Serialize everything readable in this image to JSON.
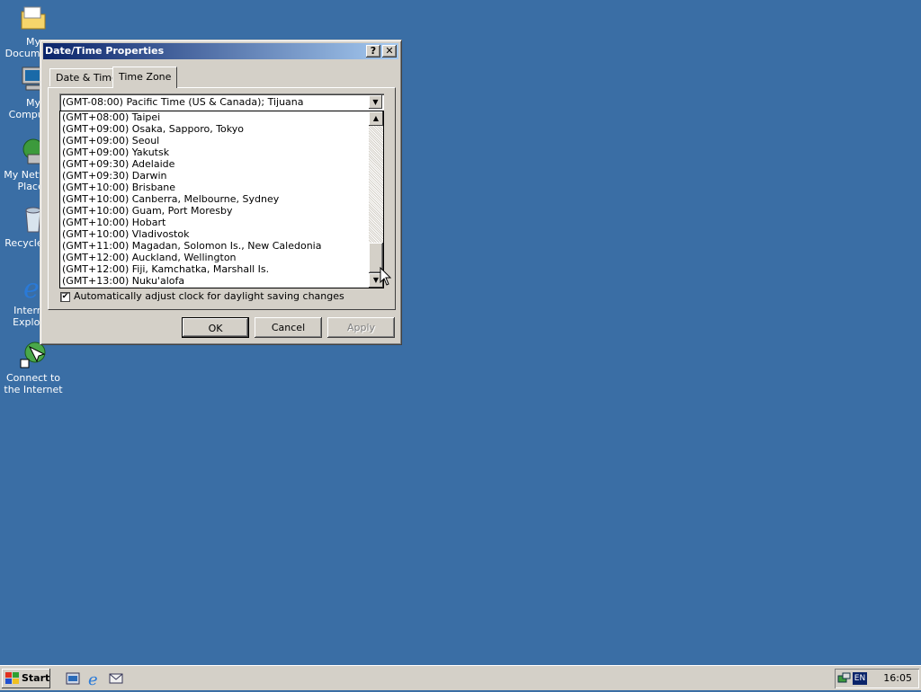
{
  "desktop": {
    "icons": [
      {
        "label": "My Documents",
        "icon": "folder-documents-icon"
      },
      {
        "label": "My Computer",
        "icon": "computer-icon"
      },
      {
        "label": "My Network Places",
        "icon": "network-places-icon"
      },
      {
        "label": "Recycle Bin",
        "icon": "recycle-bin-icon"
      },
      {
        "label": "Internet Explorer",
        "icon": "internet-explorer-icon"
      },
      {
        "label": "Connect to the Internet",
        "icon": "connect-internet-icon"
      }
    ]
  },
  "window": {
    "title": "Date/Time Properties",
    "help_button": "?",
    "close_button": "✕",
    "tabs": [
      {
        "label": "Date & Time"
      },
      {
        "label": "Time Zone"
      }
    ],
    "active_tab": "Time Zone",
    "timezone_selected": "(GMT-08:00) Pacific Time (US & Canada); Tijuana",
    "timezone_options": [
      "(GMT+08:00) Taipei",
      "(GMT+09:00) Osaka, Sapporo, Tokyo",
      "(GMT+09:00) Seoul",
      "(GMT+09:00) Yakutsk",
      "(GMT+09:30) Adelaide",
      "(GMT+09:30) Darwin",
      "(GMT+10:00) Brisbane",
      "(GMT+10:00) Canberra, Melbourne, Sydney",
      "(GMT+10:00) Guam, Port Moresby",
      "(GMT+10:00) Hobart",
      "(GMT+10:00) Vladivostok",
      "(GMT+11:00) Magadan, Solomon Is., New Caledonia",
      "(GMT+12:00) Auckland, Wellington",
      "(GMT+12:00) Fiji, Kamchatka, Marshall Is.",
      "(GMT+13:00) Nuku'alofa"
    ],
    "daylight_checkbox_label": "Automatically adjust clock for daylight saving changes",
    "daylight_checked": true,
    "buttons": {
      "ok": "OK",
      "cancel": "Cancel",
      "apply": "Apply"
    }
  },
  "taskbar": {
    "start_label": "Start",
    "language": "EN",
    "clock": "16:05"
  },
  "colors": {
    "desktop": "#3a6ea5",
    "titlebar_start": "#0a246a",
    "titlebar_end": "#a6caf0",
    "face": "#d4d0c8"
  }
}
